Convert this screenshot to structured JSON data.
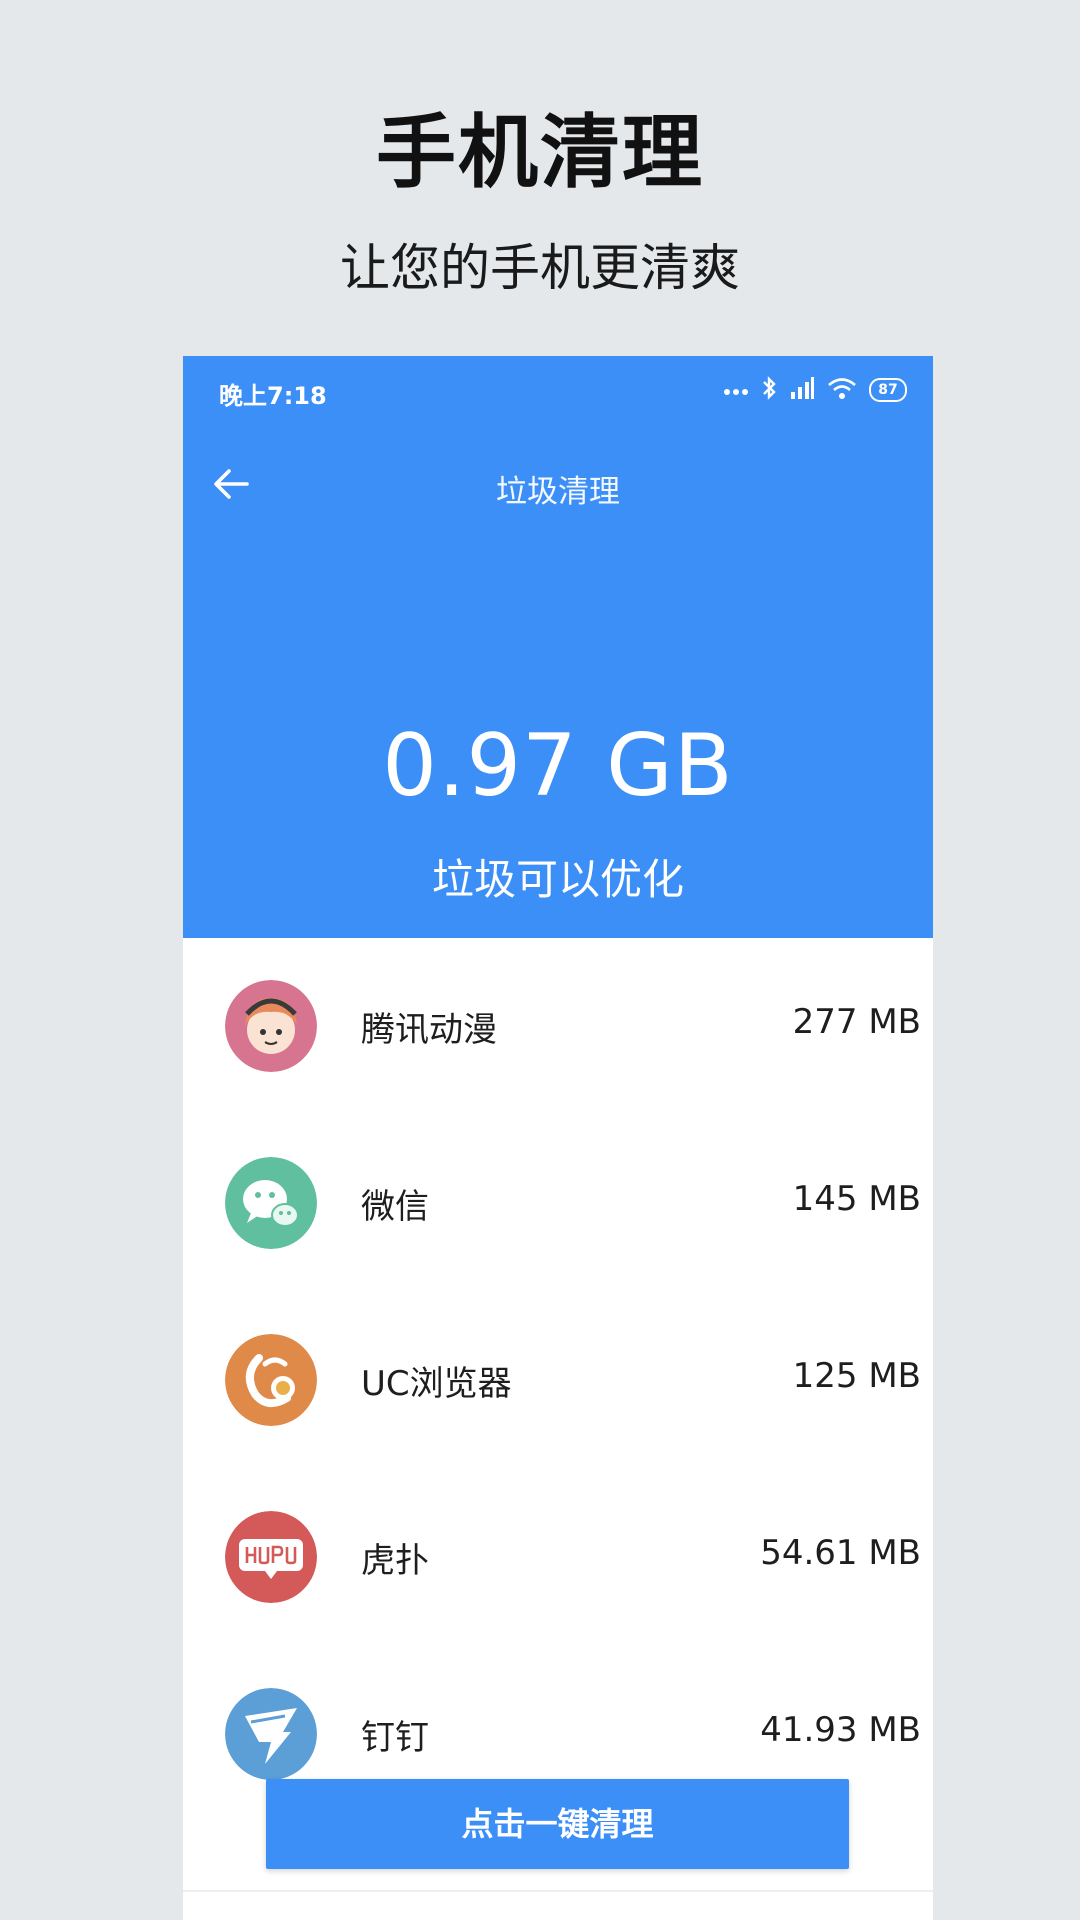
{
  "promo": {
    "title": "手机清理",
    "subtitle": "让您的手机更清爽"
  },
  "status_bar": {
    "time": "晚上7:18",
    "battery": "87",
    "icons": [
      "signal-dots-icon",
      "bluetooth-icon",
      "cellular-signal-icon",
      "wifi-icon",
      "battery-icon"
    ]
  },
  "nav": {
    "back_icon": "arrow-left-icon",
    "title": "垃圾清理"
  },
  "summary": {
    "junk_size": "0.97 GB",
    "caption": "垃圾可以优化"
  },
  "apps": [
    {
      "name": "腾讯动漫",
      "size": "277 MB",
      "icon": "tencent-comic-icon",
      "color": "#d7748f"
    },
    {
      "name": "微信",
      "size": "145 MB",
      "icon": "wechat-icon",
      "color": "#5fbf9f"
    },
    {
      "name": "UC浏览器",
      "size": "125 MB",
      "icon": "uc-browser-icon",
      "color": "#e08a4a"
    },
    {
      "name": "虎扑",
      "size": "54.61 MB",
      "icon": "hupu-icon",
      "color": "#d45a5a"
    },
    {
      "name": "钉钉",
      "size": "41.93 MB",
      "icon": "dingtalk-icon",
      "color": "#5b9fd6"
    }
  ],
  "action": {
    "clean_label": "点击一键清理"
  },
  "colors": {
    "accent": "#3c8ff7",
    "background": "#e4e8eb"
  }
}
